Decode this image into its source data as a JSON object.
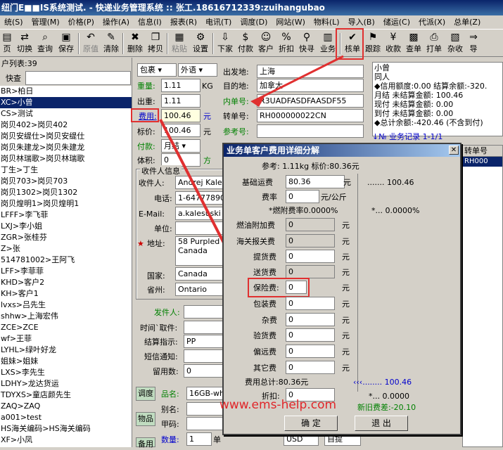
{
  "window": {
    "title": "纽门E■■IS系统测试. - 快递业务管理系统 :: 张工.18616712339:zuihangubao"
  },
  "menu": [
    "统(S)",
    "管理(M)",
    "价格(P)",
    "操作(A)",
    "信息(I)",
    "报表(R)",
    "电讯(T)",
    "调度(D)",
    "网站(W)",
    "物料(L)",
    "导入(B)",
    "储运(C)",
    "代派(X)",
    "总单(Z)"
  ],
  "toolbar": [
    {
      "label": "页",
      "icon": "▤",
      "disabled": false
    },
    {
      "label": "切换",
      "icon": "⇄",
      "disabled": false
    },
    {
      "label": "查询",
      "icon": "⌕",
      "disabled": false
    },
    {
      "label": "保存",
      "icon": "▣",
      "disabled": false
    },
    {
      "label": "原值",
      "icon": "↶",
      "disabled": true
    },
    {
      "label": "清除",
      "icon": "✎",
      "disabled": false
    },
    {
      "label": "删除",
      "icon": "✖",
      "disabled": false
    },
    {
      "label": "拷贝",
      "icon": "❐",
      "disabled": false
    },
    {
      "label": "粘贴",
      "icon": "▦",
      "disabled": true
    },
    {
      "label": "设置",
      "icon": "⚙",
      "disabled": false
    },
    {
      "label": "下家",
      "icon": "⇩",
      "disabled": false
    },
    {
      "label": "付款",
      "icon": "$",
      "disabled": false
    },
    {
      "label": "客户",
      "icon": "☺",
      "disabled": false
    },
    {
      "label": "折扣",
      "icon": "%",
      "disabled": false
    },
    {
      "label": "快寻",
      "icon": "⚲",
      "disabled": false
    },
    {
      "label": "业务",
      "icon": "▥",
      "disabled": false
    },
    {
      "label": "核单",
      "icon": "✔",
      "disabled": false
    },
    {
      "label": "跟踪",
      "icon": "⚑",
      "disabled": false
    },
    {
      "label": "收款",
      "icon": "¥",
      "disabled": false
    },
    {
      "label": "查单",
      "icon": "▩",
      "disabled": false
    },
    {
      "label": "打单",
      "icon": "⎙",
      "disabled": false
    },
    {
      "label": "杂收",
      "icon": "▧",
      "disabled": false
    },
    {
      "label": "导",
      "icon": "⇒",
      "disabled": false
    }
  ],
  "left": {
    "header": "户列表:39",
    "search_label": "快查",
    "customers": [
      "BR>柏日",
      "XC>小曾",
      "CS>测试",
      "岗贝402>岗贝402",
      "岗贝安缇仕>岗贝安缇仕",
      "岗贝朱建龙>岗贝朱建龙",
      "岗贝林瑞歌>岗贝林瑞歌",
      "丁生>丁生",
      "岗贝703>岗贝703",
      "岗贝1302>岗贝1302",
      "岗贝煌明1>岗贝煌明1",
      "LFFF>李飞菲",
      "LXJ>李小姐",
      "ZGR>张桂芬",
      "Z>张",
      "514781002>王阿飞",
      "LFF>李菲菲",
      "KHD>客户2",
      "KH>客户1",
      "lvxs>吕先生",
      "shhw>上海宏伟",
      "ZCE>ZCE",
      "wf>王菲",
      "LYHL>绿叶好龙",
      "姐妹>姐妹",
      "LXS>李先生",
      "LDHY>龙达货运",
      "TDYXS>童店颜先生",
      "ZAQ>ZAQ",
      "a001>test",
      "HS海关编码>HS海关编码",
      "XF>小凤"
    ],
    "selected_index": 1
  },
  "main": {
    "pack": "包裹",
    "type": "外语",
    "weight_label": "重量:",
    "weight": "1.11",
    "weight_unit": "KG",
    "outweight_label": "出重:",
    "outweight": "1.11",
    "fee_label": "费用:",
    "fee": "100.46",
    "fee_unit": "元",
    "price_label": "标价:",
    "price": "100.46",
    "price_unit": "元",
    "pay_label": "付款:",
    "pay": "月结",
    "volume_label": "体积:",
    "volume": "0",
    "fang": "方",
    "origin_label": "出发地:",
    "origin": "上海",
    "dest_label": "目的地:",
    "dest": "加拿大",
    "inner_label": "内单号:",
    "inner": "R3UADFASDFAASDF55",
    "transfer_label": "转单号:",
    "transfer": "RH000000022CN",
    "ref_label": "参考号:",
    "ref": "",
    "recv_title": "收件人信息",
    "recv_name_label": "收件人:",
    "recv_name": "Andrej Kale",
    "phone_label": "电话:",
    "phone": "1-647778906",
    "email_label": "E-Mail:",
    "email": "a.kalesuski",
    "unit_label": "单位:",
    "unit": "",
    "addr_label": "地址:",
    "addr": "58 Purpled Canada",
    "country_label": "国家:",
    "country": "Canada",
    "state_label": "省州:",
    "state": "Ontario",
    "sender_label": "发件人:",
    "sender": "",
    "time_label": "时间`取件:",
    "time": "",
    "settle_label": "结算指示:",
    "settle": "PP",
    "sms_label": "短信通知:",
    "sms": "",
    "leave_label": "留用数:",
    "leave": "0",
    "tab1": "调度",
    "tab2": "物品",
    "tab3": "备用",
    "goods_label": "品名:",
    "goods": "16GB-whi",
    "alias_label": "别名:",
    "alias": "",
    "code_label": "甲码:",
    "code": "",
    "qty_label": "数量:",
    "qty": "1",
    "qty_unit": "单",
    "extra1": "USD",
    "extra2": "自提"
  },
  "right": {
    "name": "小曾",
    "role": "同人",
    "credit": "◆信用额度:0.00 结算余额:-320.",
    "monthly": "月结 未结算金额: 100.46",
    "cash": "现付 未结算金额: 0.00",
    "cod": "到付 未结算金额: 0.00",
    "total": "◆总计余额:-420.46 (不含到付)",
    "records": "↓№ 业务记录 1-1/1",
    "col_transfer": "转单号",
    "row_transfer": "RH000"
  },
  "dialog": {
    "title": "业务单客户费用详细分解",
    "ref": "参考: 1.11kg 标价:80.36元",
    "base_label": "基础运费",
    "base": "80.36",
    "base_unit": "元",
    "base_right": "....... 100.46",
    "rate_label": "费率",
    "rate": "0",
    "rate_unit": "元/公斤",
    "fuel_note": "*燃附费率0.0000%",
    "fuel_note_right": "*... 0.0000%",
    "fuel_label": "燃油附加费",
    "fuel": "0",
    "customs_label": "海关报关费",
    "customs": "0",
    "pickup_label": "提货费",
    "pickup": "0",
    "delivery_label": "送货费",
    "delivery": "0",
    "insure_label": "保险费:",
    "insure": "0",
    "pack_label": "包装费",
    "pack": "0",
    "misc_label": "杂费",
    "misc": "0",
    "check_label": "验货费",
    "check": "0",
    "remote_label": "偏远费",
    "remote": "0",
    "other_label": "其它费",
    "other": "0",
    "total_label": "费用总计:80.36元",
    "total_right": "‹‹‹........ 100.46",
    "discount_label": "折扣:",
    "discount": "0",
    "discount_right": "*... 0.0000",
    "yuan": "元",
    "newold": "新旧费差:-20.10",
    "ok": "确 定",
    "cancel": "退 出"
  },
  "watermark": "www.ems-help.com"
}
